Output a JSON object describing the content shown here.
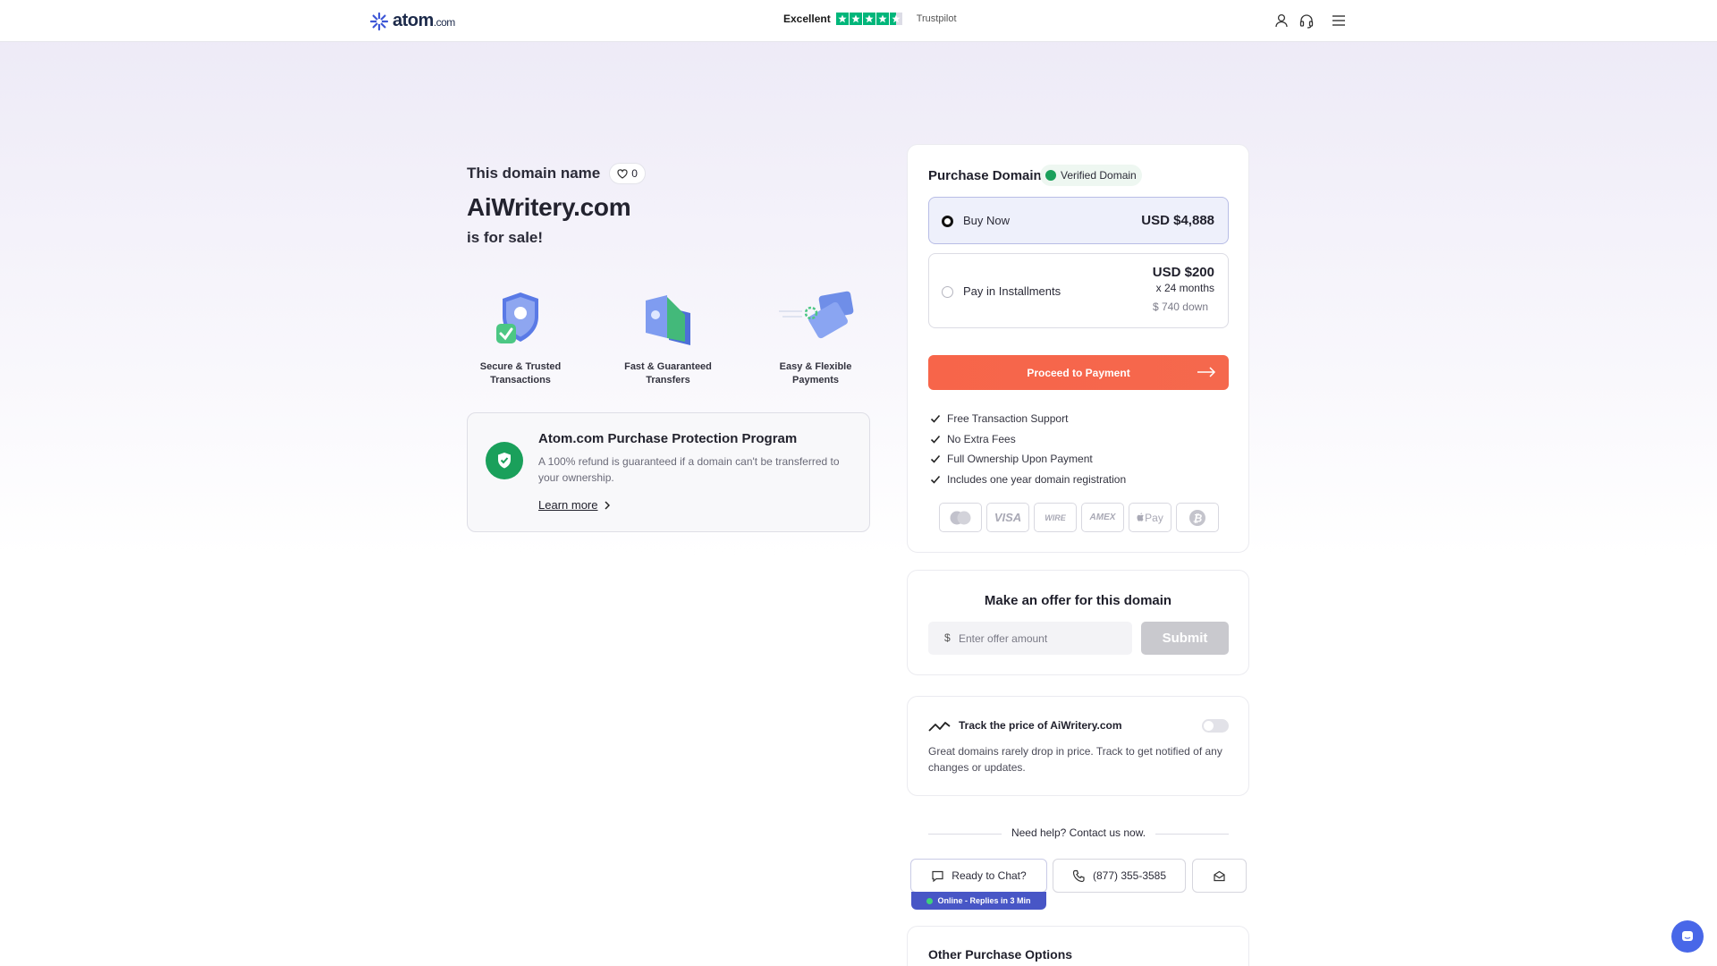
{
  "header": {
    "logo_text": "atom",
    "logo_suffix": ".com",
    "trust_label": "Excellent",
    "trust_brand": "Trustpilot",
    "trust_rating_stars": 4.5,
    "icons": [
      "user-icon",
      "headset-icon",
      "menu-icon"
    ]
  },
  "intro": {
    "line1": "This domain name",
    "likes": "0",
    "domain": "AiWritery.com",
    "line3": "is for sale!"
  },
  "features": [
    {
      "label": "Secure & Trusted Transactions",
      "icon": "shield-check-icon"
    },
    {
      "label": "Fast & Guaranteed Transfers",
      "icon": "transfer-icon"
    },
    {
      "label": "Easy & Flexible Payments",
      "icon": "card-icon"
    }
  ],
  "protection": {
    "title": "Atom.com Purchase Protection Program",
    "text": "A 100% refund is guaranteed if a domain can't be transferred to your ownership.",
    "link": "Learn more"
  },
  "purchase": {
    "title": "Purchase Domain",
    "verified": "Verified Domain",
    "buy_label": "Buy Now",
    "buy_price": "USD $4,888",
    "inst_label": "Pay in Installments",
    "inst_price": "USD $200",
    "inst_months": "x 24 months",
    "inst_down": "$ 740 down",
    "proceed": "Proceed to Payment",
    "benefits": [
      "Free Transaction Support",
      "No Extra Fees",
      "Full Ownership Upon Payment",
      "Includes one year domain registration"
    ],
    "payment_methods": [
      "mastercard-icon",
      "VISA",
      "WIRE",
      "AMEX",
      "Pay",
      "bitcoin-icon"
    ],
    "accent": "#f6654a"
  },
  "offer": {
    "title": "Make an offer for this domain",
    "currency": "$",
    "placeholder": "Enter offer amount",
    "submit": "Submit"
  },
  "track": {
    "title": "Track the price of AiWritery.com",
    "text": "Great domains rarely drop in price. Track to get notified of any changes or updates.",
    "enabled": false
  },
  "help": {
    "text": "Need help? Contact us now.",
    "chat": "Ready to Chat?",
    "phone": "(877) 355-3585",
    "online": "Online - Replies in 3 Min"
  },
  "other": {
    "title": "Other Purchase Options"
  }
}
